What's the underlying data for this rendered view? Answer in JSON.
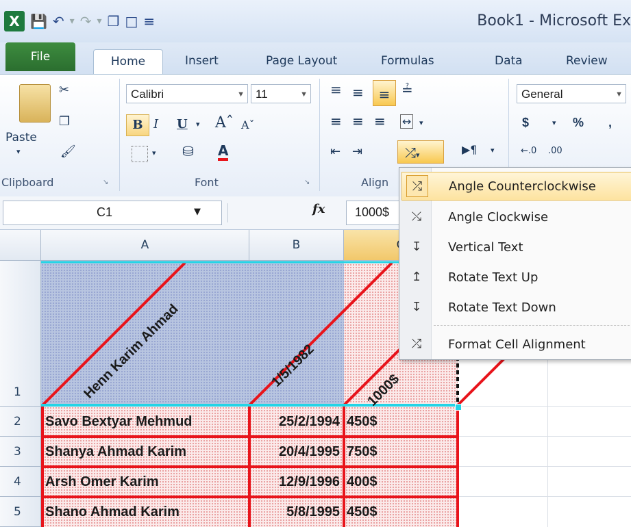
{
  "title": "Book1 - Microsoft Ex",
  "tabs": [
    "File",
    "Home",
    "Insert",
    "Page Layout",
    "Formulas",
    "Data",
    "Review"
  ],
  "clipboard": {
    "paste": "Paste",
    "group": "Clipboard"
  },
  "font": {
    "name": "Calibri",
    "size": "11",
    "bold": "B",
    "italic": "I",
    "underline": "U",
    "group": "Font"
  },
  "alignment": {
    "group": "Align"
  },
  "number": {
    "format": "General",
    "currency": "$",
    "percent": "%",
    "comma": ","
  },
  "formula_bar": {
    "name_box": "C1",
    "fx": "fx",
    "value": "1000$"
  },
  "columns": [
    "A",
    "B",
    "C"
  ],
  "rows": [
    {
      "num": "1",
      "a": "Henn Karim Ahmad",
      "b": "1/5/1982",
      "c": "1000$"
    },
    {
      "num": "2",
      "a": "Savo Bextyar Mehmud",
      "b": "25/2/1994",
      "c": "450$"
    },
    {
      "num": "3",
      "a": "Shanya Ahmad Karim",
      "b": "20/4/1995",
      "c": "750$"
    },
    {
      "num": "4",
      "a": "Arsh Omer Karim",
      "b": "12/9/1996",
      "c": "400$"
    },
    {
      "num": "5",
      "a": "Shano Ahmad Karim",
      "b": "5/8/1995",
      "c": "450$"
    }
  ],
  "menu": {
    "items": [
      {
        "label": "Angle Counterclockwise",
        "icon": "angle-ccw-icon"
      },
      {
        "label": "Angle Clockwise",
        "icon": "angle-cw-icon"
      },
      {
        "label": "Vertical Text",
        "icon": "vertical-text-icon"
      },
      {
        "label": "Rotate Text Up",
        "icon": "rotate-up-icon"
      },
      {
        "label": "Rotate Text Down",
        "icon": "rotate-down-icon"
      },
      {
        "label": "Format Cell Alignment",
        "icon": "format-alignment-icon"
      }
    ]
  },
  "colors": {
    "accent_green": "#2b6e2f",
    "border_red": "#e8141b",
    "highlight": "#fde3a0",
    "selection_cyan": "#23d4e6"
  }
}
